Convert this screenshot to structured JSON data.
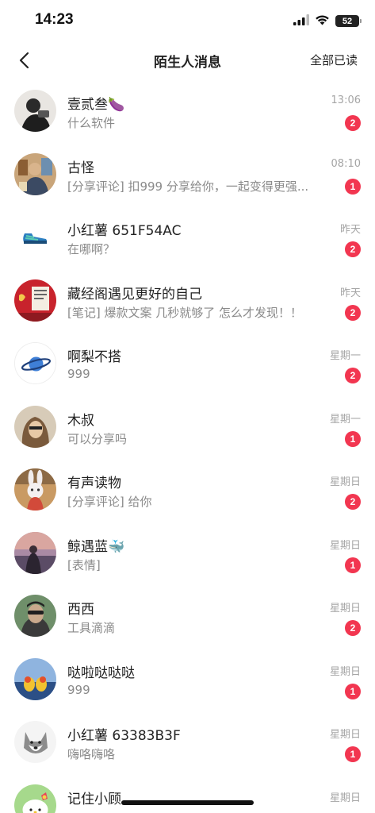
{
  "status_bar": {
    "time": "14:23",
    "battery": "52"
  },
  "nav": {
    "title": "陌生人消息",
    "mark_all_read": "全部已读"
  },
  "conversations": [
    {
      "name": "壹贰叁🍆",
      "preview": "什么软件",
      "time": "13:06",
      "badge": "2"
    },
    {
      "name": "古怪",
      "preview": "[分享评论] 扣999 分享给你，一起变得更强...",
      "time": "08:10",
      "badge": "1"
    },
    {
      "name": "小红薯 651F54AC",
      "preview": "在哪啊？",
      "time": "昨天",
      "badge": "2"
    },
    {
      "name": "藏经阁遇见更好的自己",
      "preview": "[笔记] 爆款文案 几秒就够了 怎么才发现！！",
      "time": "昨天",
      "badge": "2"
    },
    {
      "name": "啊梨不搭",
      "preview": "999",
      "time": "星期一",
      "badge": "2"
    },
    {
      "name": "木叔",
      "preview": "可以分享吗",
      "time": "星期一",
      "badge": "1"
    },
    {
      "name": "有声读物",
      "preview": "[分享评论] 给你",
      "time": "星期日",
      "badge": "2"
    },
    {
      "name": "鲸遇蓝🐳",
      "preview": "[表情]",
      "time": "星期日",
      "badge": "1"
    },
    {
      "name": "西西",
      "preview": "工具滴滴",
      "time": "星期日",
      "badge": "2"
    },
    {
      "name": "哒啦哒哒哒",
      "preview": "999",
      "time": "星期日",
      "badge": "1"
    },
    {
      "name": "小红薯 63383B3F",
      "preview": "嗨咯嗨咯",
      "time": "星期日",
      "badge": "1"
    },
    {
      "name": "记住小顾",
      "preview": "",
      "time": "星期日",
      "badge": ""
    }
  ],
  "colors": {
    "badge": "#f23650",
    "time": "#a5a5a5",
    "preview": "#8a8a8a"
  }
}
